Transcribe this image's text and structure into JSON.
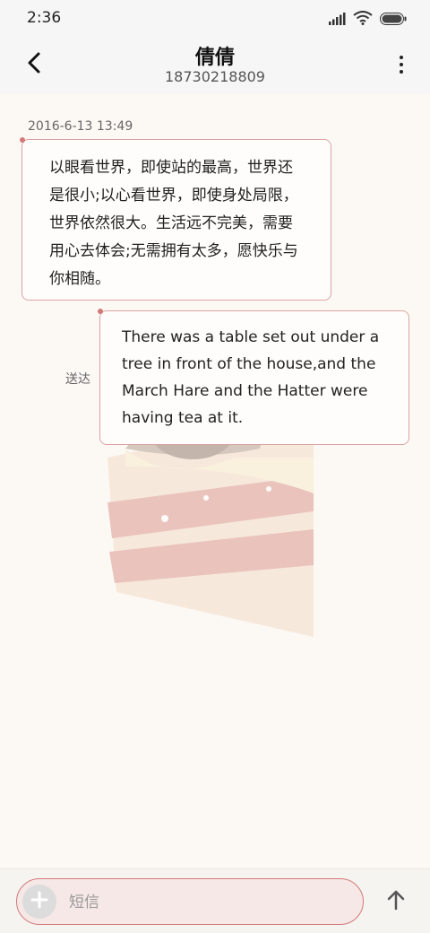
{
  "status_bar": {
    "time": "2:36",
    "icons": [
      "signal-icon",
      "wifi-icon",
      "battery-icon"
    ]
  },
  "header": {
    "contact_name": "倩倩",
    "contact_number": "18730218809",
    "back_icon": "back-arrow-icon",
    "more_icon": "more-vertical-icon"
  },
  "conversation": {
    "timestamp": "2016-6-13 13:49",
    "messages": [
      {
        "direction": "incoming",
        "text": "以眼看世界，即使站的最高，世界还是很小;以心看世界，即使身处局限，世界依然很大。生活远不完美，需要用心去体会;无需拥有太多，愿快乐与你相随。"
      },
      {
        "direction": "outgoing",
        "text": "There was a table set out under a tree in front of the house,and the March Hare and the Hatter were having tea at it.",
        "status": "送达"
      }
    ]
  },
  "composer": {
    "placeholder": "短信",
    "add_icon": "plus-icon",
    "send_icon": "send-arrow-icon"
  },
  "colors": {
    "accent": "#d27a7a",
    "bubble_border": "#d9a3a3",
    "background": "#fcf9f5"
  }
}
